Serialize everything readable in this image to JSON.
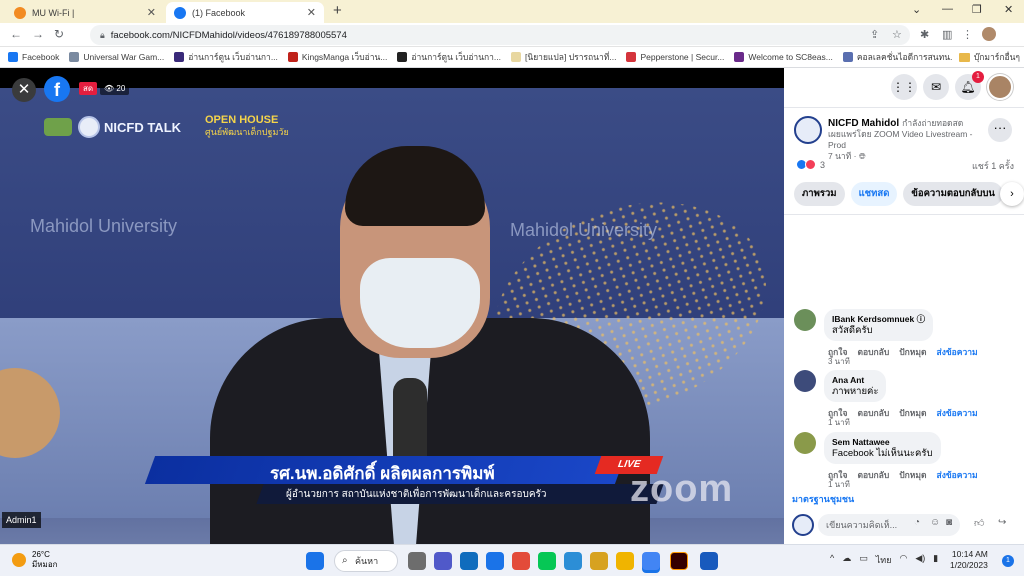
{
  "browser": {
    "tabs": [
      {
        "title": "MU Wi-Fi |",
        "favicon_color": "#f28b22"
      },
      {
        "title": "(1) Facebook",
        "favicon_color": "#1877f2"
      }
    ],
    "url": "facebook.com/NICFDMahidol/videos/476189788005574",
    "bookmarks": [
      "Facebook",
      "Universal War Gam...",
      "อ่านการ์ตูน เว็บอ่านกา...",
      "KingsManga เว็บอ่าน...",
      "อ่านการ์ตูน เว็บอ่านกา...",
      "[นิยายแปล] ปรารถนาที่...",
      "Pepperstone | Secur...",
      "Welcome to SC8eas...",
      "คอลเลคชั่นไอดีการสนทน..."
    ],
    "bookmark_folder": "บุ๊กมาร์กอื่นๆ"
  },
  "video": {
    "live_label": "สด",
    "viewers": "20",
    "admin_label": "Admin1",
    "show_title": "NICFD TALK",
    "open_house": "OPEN HOUSE",
    "open_house_sub": "ศูนย์พัฒนาเด็กปฐมวัย",
    "bg_text_1": "Mahidol University",
    "bg_text_2": "Mahidol University",
    "speaker_name": "รศ.นพ.อดิศักดิ์ ผลิตผลการพิมพ์",
    "speaker_title": "ผู้อำนวยการ  สถาบันแห่งชาติเพื่อการพัฒนาเด็กและครอบครัว",
    "live_tag": "LIVE",
    "zoom_watermark": "zoom"
  },
  "panel": {
    "notifications": "1",
    "page_name": "NICFD Mahidol",
    "status": "กำลังถ่ายทอดสด",
    "via": "เผยแพร่โดย ZOOM Video Livestream - Prod",
    "time": "7 นาที",
    "reaction_count": "3",
    "shares": "แชร์ 1 ครั้ง",
    "tabs": [
      "ภาพรวม",
      "แชทสด",
      "ข้อความตอบกลับบน"
    ],
    "comments": [
      {
        "name": "IBank Kerdsomnuek",
        "text": "สวัสดีครับ",
        "time": "3 นาที",
        "avatar_color": "#6b8f5a"
      },
      {
        "name": "Ana Ant",
        "text": "ภาพหายค่ะ",
        "time": "1 นาที",
        "avatar_color": "#3d4b7a"
      },
      {
        "name": "Sem Nattawee",
        "text": "Facebook ไม่เห็นนะครับ",
        "time": "1 นาที",
        "avatar_color": "#8a9a4a"
      }
    ],
    "comment_actions": {
      "like": "ถูกใจ",
      "reply": "ตอบกลับ",
      "hide": "ปักหมุด",
      "send": "ส่งข้อความ"
    },
    "standards_link": "มาตรฐานชุมชน",
    "composer_placeholder": "เขียนความคิดเห็..."
  },
  "taskbar": {
    "temp": "26°C",
    "weather": "มีหมอก",
    "search_label": "ค้นหา",
    "lang": "ไทย",
    "time": "10:14 AM",
    "date": "1/20/2023",
    "notif_badge": "1"
  }
}
